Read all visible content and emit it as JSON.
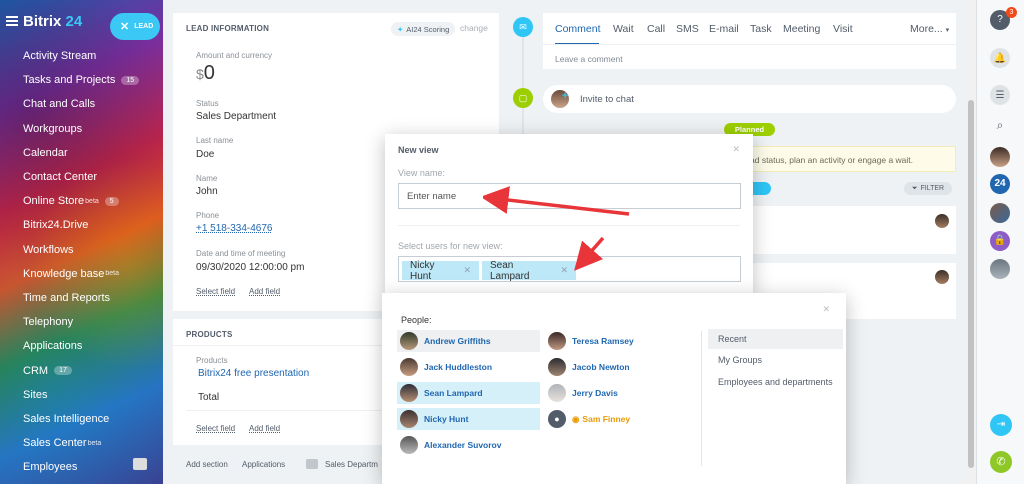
{
  "sidebar": {
    "logo_main": "Bitrix",
    "logo_num": "24",
    "lead_button": "LEAD",
    "items": [
      {
        "label": "Activity Stream",
        "badge": "",
        "sup": ""
      },
      {
        "label": "Tasks and Projects",
        "badge": "15",
        "sup": ""
      },
      {
        "label": "Chat and Calls",
        "badge": "",
        "sup": ""
      },
      {
        "label": "Workgroups",
        "badge": "",
        "sup": ""
      },
      {
        "label": "Calendar",
        "badge": "",
        "sup": ""
      },
      {
        "label": "Contact Center",
        "badge": "",
        "sup": ""
      },
      {
        "label": "Online Store",
        "badge": "5",
        "sup": "beta"
      },
      {
        "label": "Bitrix24.Drive",
        "badge": "",
        "sup": ""
      },
      {
        "label": "Workflows",
        "badge": "",
        "sup": ""
      },
      {
        "label": "Knowledge base",
        "badge": "",
        "sup": "beta"
      },
      {
        "label": "Time and Reports",
        "badge": "",
        "sup": ""
      },
      {
        "label": "Telephony",
        "badge": "",
        "sup": ""
      },
      {
        "label": "Applications",
        "badge": "",
        "sup": ""
      },
      {
        "label": "CRM",
        "badge": "17",
        "sup": ""
      },
      {
        "label": "Sites",
        "badge": "",
        "sup": ""
      },
      {
        "label": "Sales Intelligence",
        "badge": "",
        "sup": ""
      },
      {
        "label": "Sales Center",
        "badge": "",
        "sup": "beta"
      },
      {
        "label": "Employees",
        "badge": "",
        "sup": ""
      }
    ]
  },
  "lead_info": {
    "title": "LEAD INFORMATION",
    "ai_scoring": "AI24 Scoring",
    "change": "change",
    "amount_label": "Amount and currency",
    "currency": "$",
    "amount": "0",
    "status_label": "Status",
    "status": "Sales Department",
    "last_name_label": "Last name",
    "last_name": "Doe",
    "name_label": "Name",
    "name": "John",
    "phone_label": "Phone",
    "phone": "+1 518-334-4676",
    "date_label": "Date and time of meeting",
    "date": "09/30/2020 12:00:00 pm",
    "select_field": "Select field",
    "add_field": "Add field"
  },
  "products": {
    "title": "PRODUCTS",
    "label": "Products",
    "product": "Bitrix24 free presentation",
    "total": "Total",
    "select_field": "Select field",
    "add_field": "Add field"
  },
  "bottom_bar": {
    "add_section": "Add section",
    "applications": "Applications",
    "sales_dept": "Sales Departm"
  },
  "timeline": {
    "tabs": [
      "Comment",
      "Wait",
      "Call",
      "SMS",
      "E-mail",
      "Task",
      "Meeting",
      "Visit"
    ],
    "more": "More...",
    "comment_placeholder": "Leave a comment",
    "invite": "Invite to chat",
    "planned": "Planned",
    "hint": "ad status, plan an activity or engage a wait.",
    "filter": "FILTER"
  },
  "new_view": {
    "title": "New view",
    "view_name_label": "View name:",
    "view_name_placeholder": "Enter name",
    "select_users_label": "Select users for new view:",
    "chips": [
      "Nicky Hunt",
      "Sean Lampard"
    ]
  },
  "people_popup": {
    "people_label": "People:",
    "left_column": [
      "Andrew Griffiths",
      "Jack Huddleston",
      "Sean Lampard",
      "Nicky Hunt",
      "Alexander Suvorov"
    ],
    "right_column": [
      "Teresa Ramsey",
      "Jacob Newton",
      "Jerry Davis",
      "Sam Finney"
    ],
    "tabs": [
      "Recent",
      "My Groups",
      "Employees and departments"
    ]
  },
  "right_bar": {
    "help_badge": "3",
    "b24": "24"
  },
  "colors": {
    "accent": "#3bc8f5",
    "link": "#2067b0",
    "planned": "#9dcf00",
    "chip": "#bde8f7",
    "arrow": "#e8353a"
  }
}
